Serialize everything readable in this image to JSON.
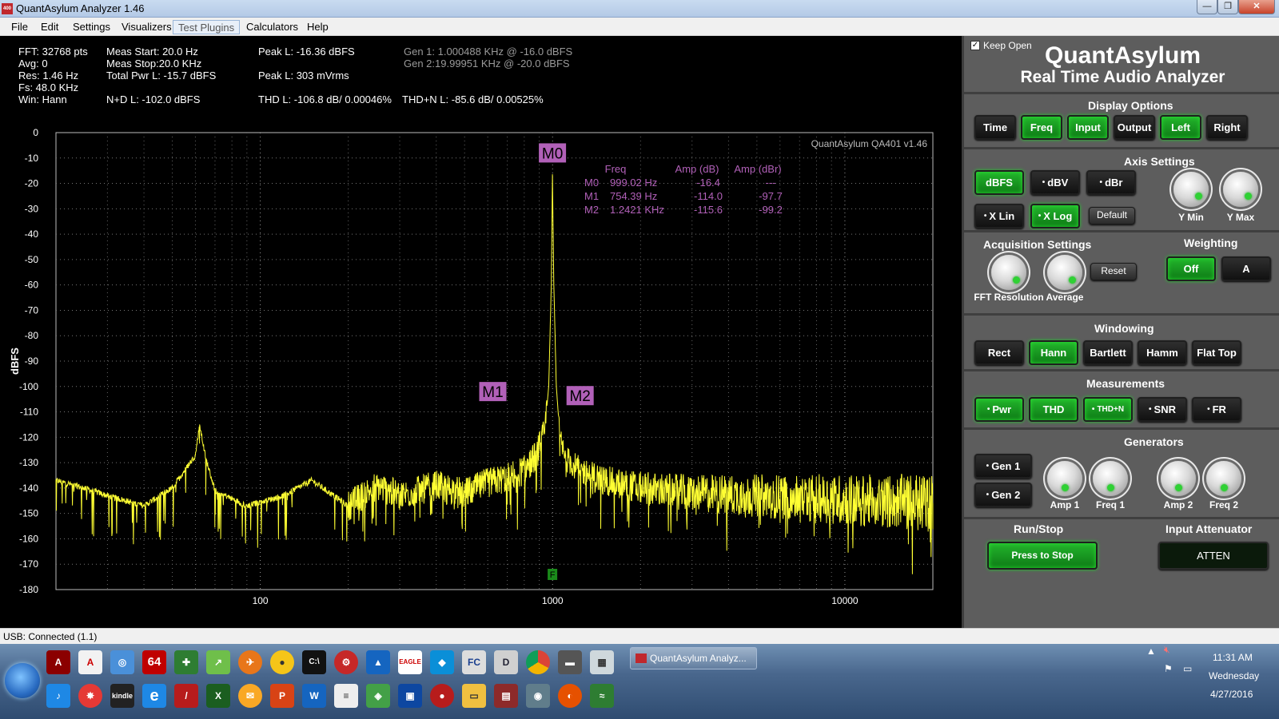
{
  "window": {
    "title": "QuantAsylum Analyzer 1.46",
    "app_icon_text": "400",
    "controls": [
      "—",
      "❐",
      "✕"
    ]
  },
  "menu": [
    "File",
    "Edit",
    "Settings",
    "Visualizers",
    "Test Plugins",
    "Calculators",
    "Help"
  ],
  "readouts": {
    "fft": "FFT: 32768 pts",
    "avg": "Avg: 0",
    "res": "Res: 1.46 Hz",
    "fs": "Fs: 48.0 KHz",
    "win": "Win: Hann",
    "meas_start": "Meas Start: 20.0 Hz",
    "meas_stop": "Meas Stop:20.0 KHz",
    "total_pwr": "Total Pwr L: -15.7 dBFS",
    "nd": "N+D L: -102.0 dBFS",
    "peak_l_dbfs": "Peak L: -16.36 dBFS",
    "peak_l_mv": "Peak L: 303 mVrms",
    "thd": "THD L: -106.8 dB/ 0.00046%",
    "thdn": "THD+N L: -85.6 dB/ 0.00525%",
    "gen1": "Gen 1: 1.000488 KHz @ -16.0  dBFS",
    "gen2": "Gen 2:19.99951 KHz @ -20.0  dBFS"
  },
  "chart_data": {
    "type": "line",
    "title": "",
    "watermark": "QuantAsylum QA401 v1.46",
    "xlabel": "",
    "ylabel": "dBFS",
    "x_scale": "log",
    "xlim": [
      20,
      20000
    ],
    "ylim": [
      -180,
      0
    ],
    "x_ticks": [
      100,
      1000,
      10000
    ],
    "x_tick_labels": [
      "100",
      "1000",
      "10000"
    ],
    "y_ticks": [
      0,
      -10,
      -20,
      -30,
      -40,
      -50,
      -60,
      -70,
      -80,
      -90,
      -100,
      -110,
      -120,
      -130,
      -140,
      -150,
      -160,
      -170,
      -180
    ],
    "grid": true,
    "line_color": "#ffff33",
    "series": [
      {
        "points": [
          [
            20,
            -137
          ],
          [
            25,
            -140
          ],
          [
            30,
            -143
          ],
          [
            40,
            -147
          ],
          [
            50,
            -140
          ],
          [
            60,
            -127
          ],
          [
            62,
            -115
          ],
          [
            65,
            -128
          ],
          [
            70,
            -141
          ],
          [
            90,
            -147
          ],
          [
            120,
            -143
          ],
          [
            150,
            -137
          ],
          [
            200,
            -147
          ],
          [
            250,
            -139
          ],
          [
            300,
            -143
          ],
          [
            400,
            -139
          ],
          [
            500,
            -142
          ],
          [
            600,
            -138
          ],
          [
            700,
            -136
          ],
          [
            800,
            -133
          ],
          [
            880,
            -127
          ],
          [
            940,
            -118
          ],
          [
            970,
            -100
          ],
          [
            990,
            -60
          ],
          [
            999,
            -16.4
          ],
          [
            1010,
            -60
          ],
          [
            1030,
            -100
          ],
          [
            1060,
            -120
          ],
          [
            1100,
            -128
          ],
          [
            1242,
            -133
          ],
          [
            1500,
            -137
          ],
          [
            2000,
            -140
          ],
          [
            3000,
            -142
          ],
          [
            5000,
            -143
          ],
          [
            8000,
            -144
          ],
          [
            12000,
            -145
          ],
          [
            20000,
            -146
          ]
        ]
      }
    ],
    "markers_table": {
      "headers": [
        "Freq",
        "Amp (dB)",
        "Amp (dBr)"
      ],
      "rows": [
        {
          "name": "M0",
          "freq": "999.02 Hz",
          "amp_db": "-16.4",
          "amp_dbr": "---"
        },
        {
          "name": "M1",
          "freq": "754.39 Hz",
          "amp_db": "-114.0",
          "amp_dbr": "-97.7"
        },
        {
          "name": "M2",
          "freq": "1.2421 KHz",
          "amp_db": "-115.6",
          "amp_dbr": "-99.2"
        }
      ]
    },
    "marker_labels": [
      "M0",
      "M1",
      "M2"
    ],
    "fundamental_marker": "F",
    "marker_color": "#b160b8"
  },
  "panel": {
    "keep_open": "Keep Open",
    "keep_open_checked": "✓",
    "brand_name": "QuantAsylum",
    "brand_sub": "Real Time Audio Analyzer",
    "display_options": {
      "title": "Display Options",
      "buttons": [
        {
          "label": "Time",
          "on": false
        },
        {
          "label": "Freq",
          "on": true
        },
        {
          "label": "Input",
          "on": true
        },
        {
          "label": "Output",
          "on": false
        },
        {
          "label": "Left",
          "on": true
        },
        {
          "label": "Right",
          "on": false
        }
      ]
    },
    "axis_settings": {
      "title": "Axis Settings",
      "dbfs": "dBFS",
      "dbv": "dBV",
      "dbr": "dBr",
      "xlin": "X Lin",
      "xlog": "X Log",
      "default": "Default",
      "ymin": "Y Min",
      "ymax": "Y Max"
    },
    "acquisition": {
      "title": "Acquisition Settings",
      "fft_resolution": "FFT Resolution",
      "average": "Average",
      "reset": "Reset"
    },
    "weighting": {
      "title": "Weighting",
      "off": "Off",
      "a": "A"
    },
    "windowing": {
      "title": "Windowing",
      "buttons": [
        {
          "label": "Rect",
          "on": false
        },
        {
          "label": "Hann",
          "on": true
        },
        {
          "label": "Bartlett",
          "on": false
        },
        {
          "label": "Hamm",
          "on": false
        },
        {
          "label": "Flat Top",
          "on": false
        }
      ]
    },
    "measurements": {
      "title": "Measurements",
      "buttons": [
        {
          "label": "Pwr",
          "on": true
        },
        {
          "label": "THD",
          "on": true
        },
        {
          "label": "THD+N",
          "on": true
        },
        {
          "label": "SNR",
          "on": false
        },
        {
          "label": "FR",
          "on": false
        }
      ]
    },
    "generators": {
      "title": "Generators",
      "gen1": "Gen 1",
      "gen2": "Gen 2",
      "amp1": "Amp 1",
      "freq1": "Freq 1",
      "amp2": "Amp 2",
      "freq2": "Freq 2"
    },
    "run_stop": {
      "title": "Run/Stop",
      "button": "Press to Stop"
    },
    "input_attenuator": {
      "title": "Input Attenuator",
      "button": "ATTEN"
    }
  },
  "status": "USB: Connected  (1.1)",
  "taskbar": {
    "active_window": "QuantAsylum Analyz...",
    "time": "11:31 AM",
    "day": "Wednesday",
    "date": "4/27/2016",
    "icon_labels": [
      "64",
      "EAGLE",
      "FC",
      "kindle"
    ]
  }
}
